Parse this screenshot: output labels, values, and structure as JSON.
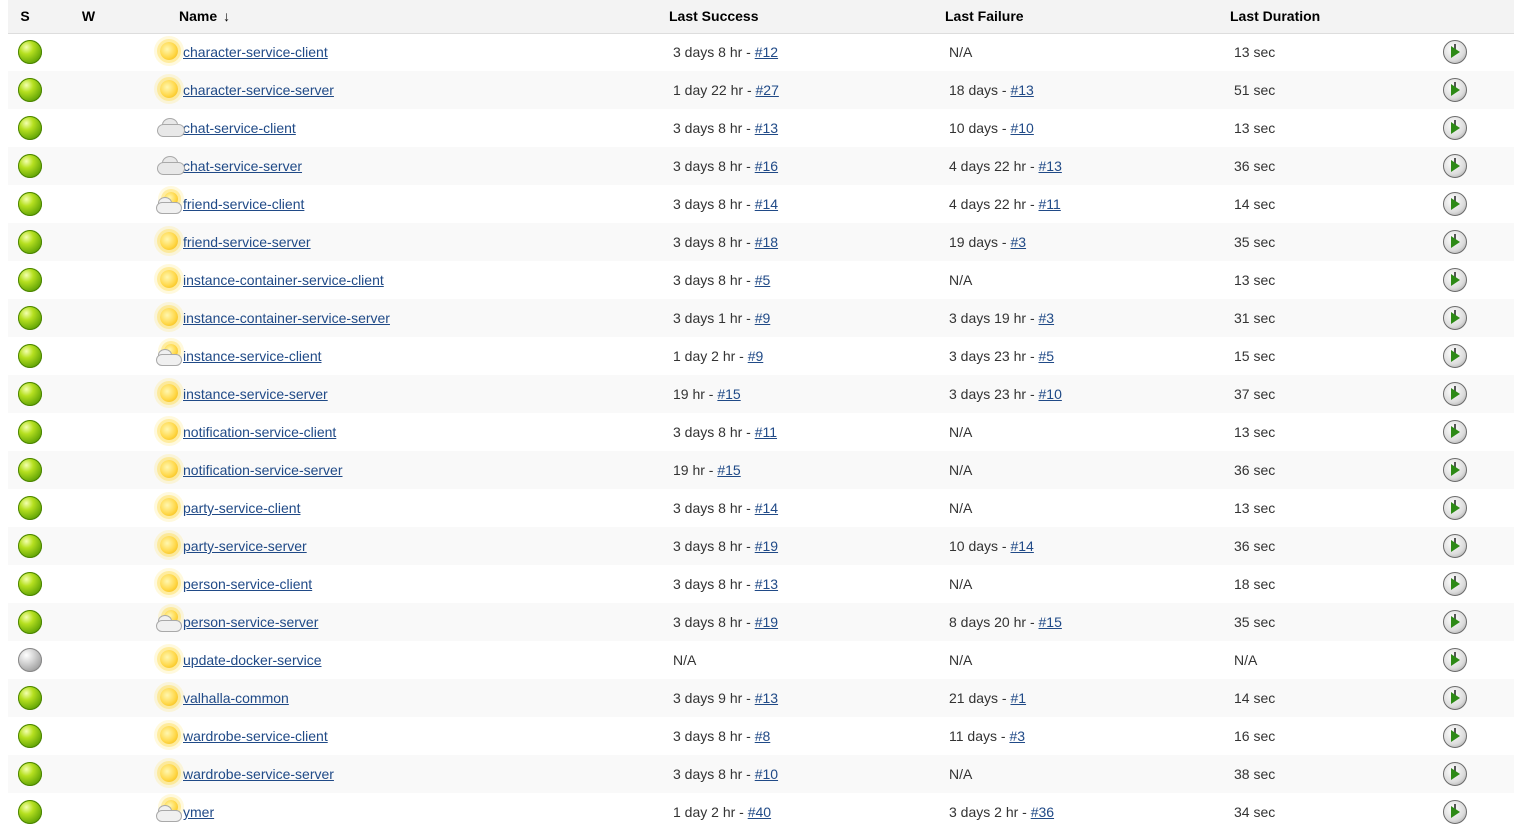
{
  "columns": {
    "status": "S",
    "weather": "W",
    "name": "Name",
    "sort_indicator": "↓",
    "last_success": "Last Success",
    "last_failure": "Last Failure",
    "last_duration": "Last Duration"
  },
  "colors": {
    "link": "#204a87",
    "header_bg": "#f3f3f3",
    "status_success": "#6aaa08",
    "status_notbuilt": "#a0a0a0"
  },
  "rows": [
    {
      "status": "success",
      "weather": "sunny-icon",
      "name": "character-service-client",
      "ls_text": "3 days 8 hr - ",
      "ls_link": "#12",
      "lf_text": "N/A",
      "lf_link": "",
      "duration": "13 sec"
    },
    {
      "status": "success",
      "weather": "sunny-icon",
      "name": "character-service-server",
      "ls_text": "1 day 22 hr - ",
      "ls_link": "#27",
      "lf_text": "18 days - ",
      "lf_link": "#13",
      "duration": "51 sec"
    },
    {
      "status": "success",
      "weather": "cloudy-icon",
      "name": "chat-service-client",
      "ls_text": "3 days 8 hr - ",
      "ls_link": "#13",
      "lf_text": "10 days - ",
      "lf_link": "#10",
      "duration": "13 sec"
    },
    {
      "status": "success",
      "weather": "cloudy-icon",
      "name": "chat-service-server",
      "ls_text": "3 days 8 hr - ",
      "ls_link": "#16",
      "lf_text": "4 days 22 hr - ",
      "lf_link": "#13",
      "duration": "36 sec"
    },
    {
      "status": "success",
      "weather": "partly-cloudy-icon",
      "name": "friend-service-client",
      "ls_text": "3 days 8 hr - ",
      "ls_link": "#14",
      "lf_text": "4 days 22 hr - ",
      "lf_link": "#11",
      "duration": "14 sec"
    },
    {
      "status": "success",
      "weather": "sunny-icon",
      "name": "friend-service-server",
      "ls_text": "3 days 8 hr - ",
      "ls_link": "#18",
      "lf_text": "19 days - ",
      "lf_link": "#3",
      "duration": "35 sec"
    },
    {
      "status": "success",
      "weather": "sunny-icon",
      "name": "instance-container-service-client",
      "ls_text": "3 days 8 hr - ",
      "ls_link": "#5",
      "lf_text": "N/A",
      "lf_link": "",
      "duration": "13 sec"
    },
    {
      "status": "success",
      "weather": "sunny-icon",
      "name": "instance-container-service-server",
      "ls_text": "3 days 1 hr - ",
      "ls_link": "#9",
      "lf_text": "3 days 19 hr - ",
      "lf_link": "#3",
      "duration": "31 sec"
    },
    {
      "status": "success",
      "weather": "partly-cloudy-icon",
      "name": "instance-service-client",
      "ls_text": "1 day 2 hr - ",
      "ls_link": "#9",
      "lf_text": "3 days 23 hr - ",
      "lf_link": "#5",
      "duration": "15 sec"
    },
    {
      "status": "success",
      "weather": "sunny-icon",
      "name": "instance-service-server",
      "ls_text": "19 hr - ",
      "ls_link": "#15",
      "lf_text": "3 days 23 hr - ",
      "lf_link": "#10",
      "duration": "37 sec"
    },
    {
      "status": "success",
      "weather": "sunny-icon",
      "name": "notification-service-client",
      "ls_text": "3 days 8 hr - ",
      "ls_link": "#11",
      "lf_text": "N/A",
      "lf_link": "",
      "duration": "13 sec"
    },
    {
      "status": "success",
      "weather": "sunny-icon",
      "name": "notification-service-server",
      "ls_text": "19 hr - ",
      "ls_link": "#15",
      "lf_text": "N/A",
      "lf_link": "",
      "duration": "36 sec"
    },
    {
      "status": "success",
      "weather": "sunny-icon",
      "name": "party-service-client",
      "ls_text": "3 days 8 hr - ",
      "ls_link": "#14",
      "lf_text": "N/A",
      "lf_link": "",
      "duration": "13 sec"
    },
    {
      "status": "success",
      "weather": "sunny-icon",
      "name": "party-service-server",
      "ls_text": "3 days 8 hr - ",
      "ls_link": "#19",
      "lf_text": "10 days - ",
      "lf_link": "#14",
      "duration": "36 sec"
    },
    {
      "status": "success",
      "weather": "sunny-icon",
      "name": "person-service-client",
      "ls_text": "3 days 8 hr - ",
      "ls_link": "#13",
      "lf_text": "N/A",
      "lf_link": "",
      "duration": "18 sec"
    },
    {
      "status": "success",
      "weather": "partly-cloudy-icon",
      "name": "person-service-server",
      "ls_text": "3 days 8 hr - ",
      "ls_link": "#19",
      "lf_text": "8 days 20 hr - ",
      "lf_link": "#15",
      "duration": "35 sec"
    },
    {
      "status": "notbuilt",
      "weather": "sunny-icon",
      "name": "update-docker-service",
      "ls_text": "N/A",
      "ls_link": "",
      "lf_text": "N/A",
      "lf_link": "",
      "duration": "N/A"
    },
    {
      "status": "success",
      "weather": "sunny-icon",
      "name": "valhalla-common",
      "ls_text": "3 days 9 hr - ",
      "ls_link": "#13",
      "lf_text": "21 days - ",
      "lf_link": "#1",
      "duration": "14 sec"
    },
    {
      "status": "success",
      "weather": "sunny-icon",
      "name": "wardrobe-service-client",
      "ls_text": "3 days 8 hr - ",
      "ls_link": "#8",
      "lf_text": "11 days - ",
      "lf_link": "#3",
      "duration": "16 sec"
    },
    {
      "status": "success",
      "weather": "sunny-icon",
      "name": "wardrobe-service-server",
      "ls_text": "3 days 8 hr - ",
      "ls_link": "#10",
      "lf_text": "N/A",
      "lf_link": "",
      "duration": "38 sec"
    },
    {
      "status": "success",
      "weather": "partly-cloudy-icon",
      "name": "ymer",
      "ls_text": "1 day 2 hr - ",
      "ls_link": "#40",
      "lf_text": "3 days 2 hr - ",
      "lf_link": "#36",
      "duration": "34 sec"
    }
  ]
}
